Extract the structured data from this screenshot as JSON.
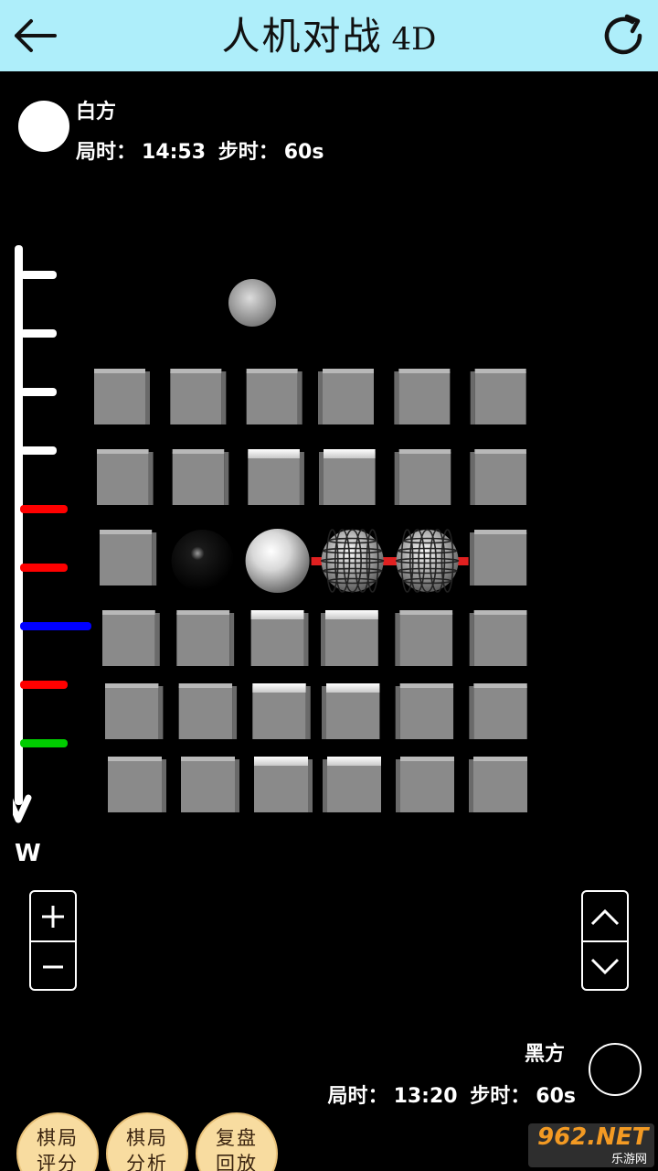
{
  "header": {
    "title": "人机对战",
    "mode_tag": "4D",
    "back_icon": "arrow-left-icon",
    "refresh_icon": "refresh-icon",
    "background": "#aeeefa"
  },
  "white_player": {
    "name": "白方",
    "game_time_label": "局时：",
    "game_time": "14:53",
    "step_time_label": "步时：",
    "step_time": "60s"
  },
  "black_player": {
    "name": "黑方",
    "game_time_label": "局时：",
    "game_time": "13:20",
    "step_time_label": "步时：",
    "step_time": "60s"
  },
  "ruler": {
    "label": "W",
    "levels": 9,
    "marker_colors": [
      "#ffffff",
      "#ffffff",
      "#ffffff",
      "#ffffff",
      "#ff0000",
      "#ff0000",
      "#0000ff",
      "#ff0000",
      "#00cc00"
    ]
  },
  "board": {
    "rows": 6,
    "cols": 6,
    "cell_color": "#8a8a8a",
    "pieces": [
      {
        "row": 2,
        "col": 1,
        "type": "black-stone"
      },
      {
        "row": 2,
        "col": 2,
        "type": "white-stone"
      },
      {
        "row": 2,
        "col": 3,
        "type": "hint-sphere"
      },
      {
        "row": 2,
        "col": 4,
        "type": "hint-sphere"
      }
    ],
    "floating_piece": "moon-stone"
  },
  "controls": {
    "zoom_in": "+",
    "zoom_out": "−",
    "level_up_icon": "chevron-up-icon",
    "level_down_icon": "chevron-down-icon"
  },
  "actions": [
    {
      "line1": "棋局",
      "line2": "评分"
    },
    {
      "line1": "棋局",
      "line2": "分析"
    },
    {
      "line1": "复盘",
      "line2": "回放"
    }
  ],
  "watermark": {
    "main": "962.NET",
    "sub": "乐游网"
  }
}
